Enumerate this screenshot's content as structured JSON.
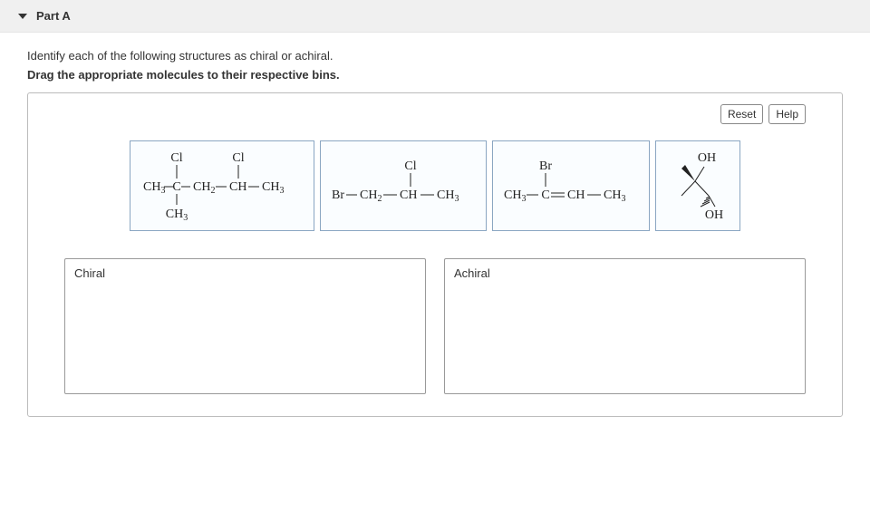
{
  "header": {
    "title": "Part A"
  },
  "instructions": {
    "line1": "Identify each of the following structures as chiral or achiral.",
    "line2": "Drag the appropriate molecules to their respective bins."
  },
  "toolbar": {
    "reset_label": "Reset",
    "help_label": "Help"
  },
  "molecules": {
    "m1": {
      "top1": "Cl",
      "top2": "Cl",
      "ch3": "CH",
      "sub3": "3",
      "c": "C",
      "ch2": "CH",
      "sub2": "2",
      "ch": "CH"
    },
    "m2": {
      "cl": "Cl",
      "br": "Br",
      "ch2": "CH",
      "sub2": "2",
      "ch": "CH",
      "ch3": "CH",
      "sub3": "3"
    },
    "m3": {
      "br": "Br",
      "ch3": "CH",
      "sub3": "3",
      "c": "C",
      "ch": "CH"
    },
    "m4": {
      "oh1": "OH",
      "oh2": "OH"
    }
  },
  "bins": {
    "chiral_label": "Chiral",
    "achiral_label": "Achiral"
  }
}
